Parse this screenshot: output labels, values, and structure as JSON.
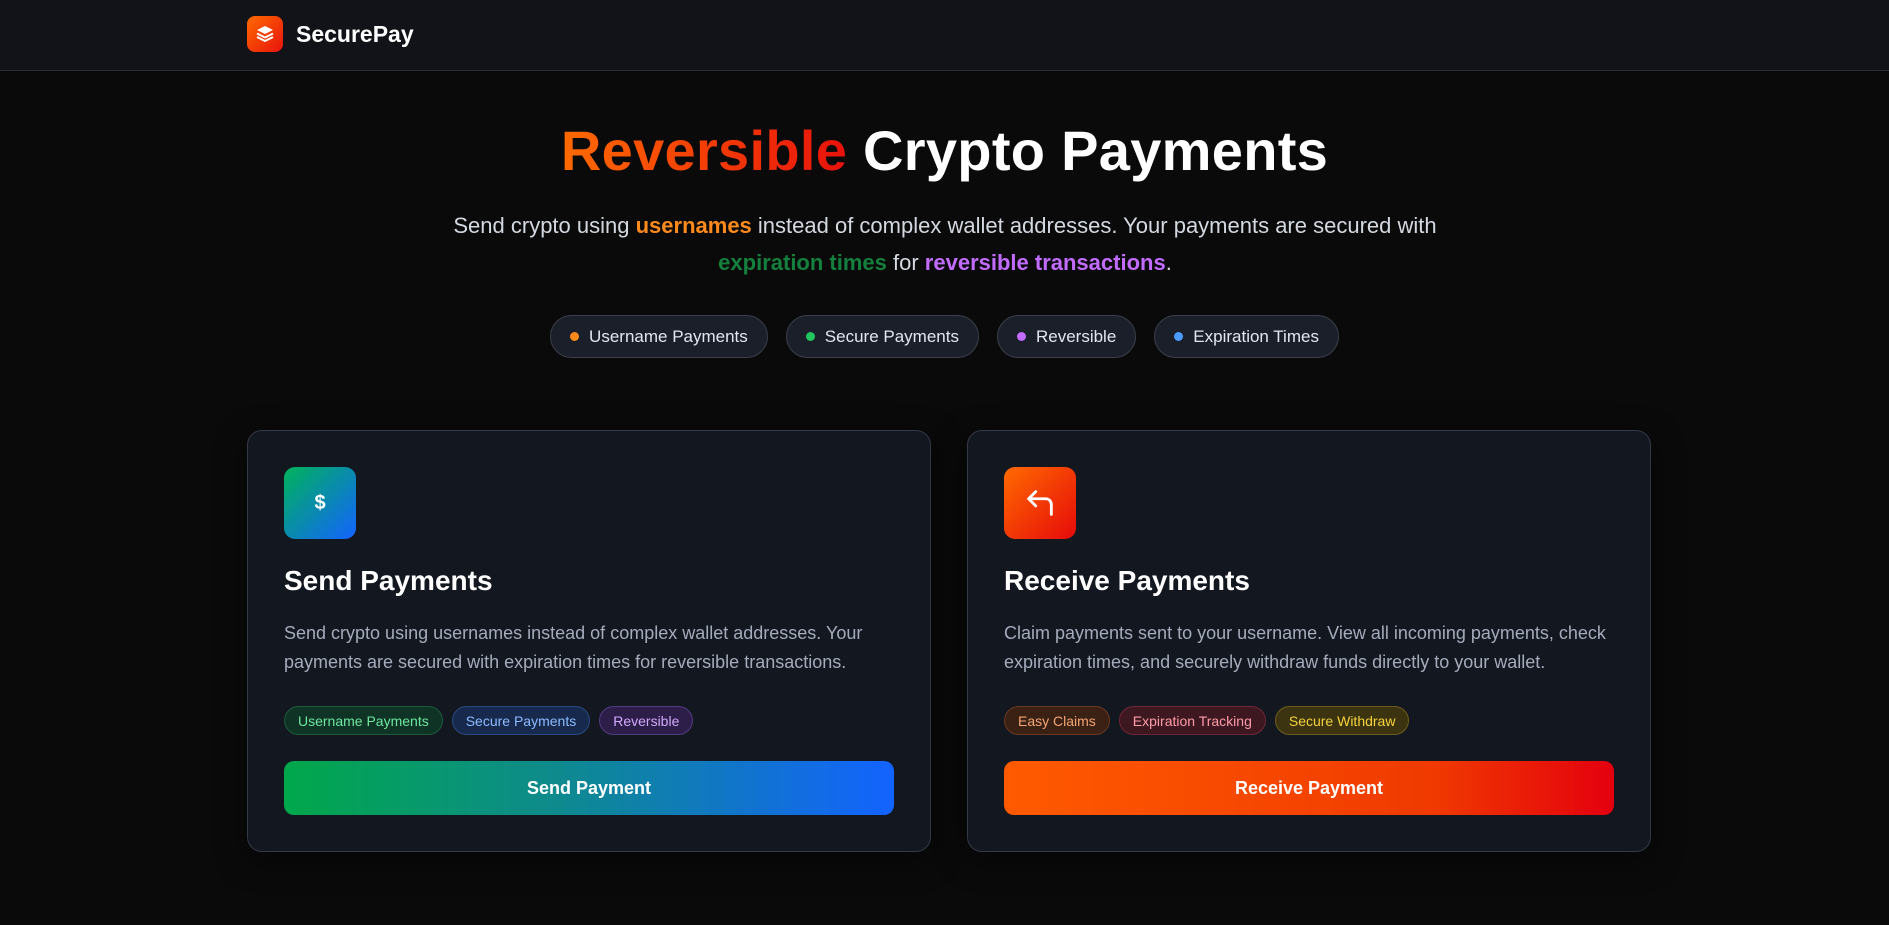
{
  "brand": {
    "name": "SecurePay",
    "logo_icon": "layers-icon"
  },
  "hero": {
    "title_accent": "Reversible",
    "title_rest": " Crypto Payments",
    "subtitle_parts": {
      "p1": "Send crypto using ",
      "hl1": "usernames",
      "p2": " instead of complex wallet addresses. Your payments are secured with ",
      "hl2": "expiration times",
      "p3": " for ",
      "hl3": "reversible transactions",
      "p4": "."
    },
    "pills": [
      {
        "label": "Username Payments",
        "color": "#ff8a1c"
      },
      {
        "label": "Secure Payments",
        "color": "#22c55e"
      },
      {
        "label": "Reversible",
        "color": "#c26bff"
      },
      {
        "label": "Expiration Times",
        "color": "#4a9dff"
      }
    ]
  },
  "send_card": {
    "icon": "dollar-icon",
    "icon_glyph": "$",
    "title": "Send Payments",
    "description": "Send crypto using usernames instead of complex wallet addresses. Your payments are secured with expiration times for reversible transactions.",
    "tags": [
      "Username Payments",
      "Secure Payments",
      "Reversible"
    ],
    "button_label": "Send Payment"
  },
  "receive_card": {
    "icon": "reply-arrow-icon",
    "title": "Receive Payments",
    "description": "Claim payments sent to your username. View all incoming payments, check expiration times, and securely withdraw funds directly to your wallet.",
    "tags": [
      "Easy Claims",
      "Expiration Tracking",
      "Secure Withdraw"
    ],
    "button_label": "Receive Payment"
  },
  "colors": {
    "background": "#0a0a0a",
    "accent_orange": "#ff6a00",
    "accent_red": "#e8120c",
    "accent_green": "#00a84a",
    "accent_blue": "#1363ff"
  }
}
